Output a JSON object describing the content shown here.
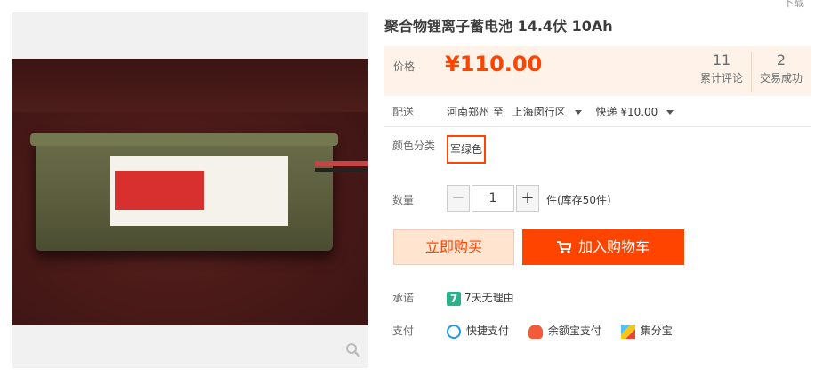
{
  "partial_top": "下载",
  "product": {
    "title": "聚合物锂离子蓄电池 14.4伏 10Ah"
  },
  "price": {
    "label": "价格",
    "currency": "¥",
    "value": "110.00",
    "reviews_count": "11",
    "reviews_label": "累计评论",
    "sales_count": "2",
    "sales_label": "交易成功"
  },
  "delivery": {
    "label": "配送",
    "from": "河南郑州 至",
    "to": "上海闵行区",
    "shipping": "快递 ¥10.00"
  },
  "color": {
    "label": "颜色分类",
    "selected": "军绿色"
  },
  "quantity": {
    "label": "数量",
    "minus": "−",
    "value": "1",
    "plus": "+",
    "stock": "件(库存50件)"
  },
  "buttons": {
    "buy_now": "立即购买",
    "add_to_cart": "加入购物车"
  },
  "promise": {
    "label": "承诺",
    "icon_text": "7",
    "text": "7天无理由"
  },
  "payment": {
    "label": "支付",
    "methods": [
      "快捷支付",
      "余额宝支付",
      "集分宝"
    ]
  },
  "colors": {
    "accent": "#ff4400",
    "price_bg": "#fff2e8",
    "buy_bg": "#ffe4d0"
  }
}
